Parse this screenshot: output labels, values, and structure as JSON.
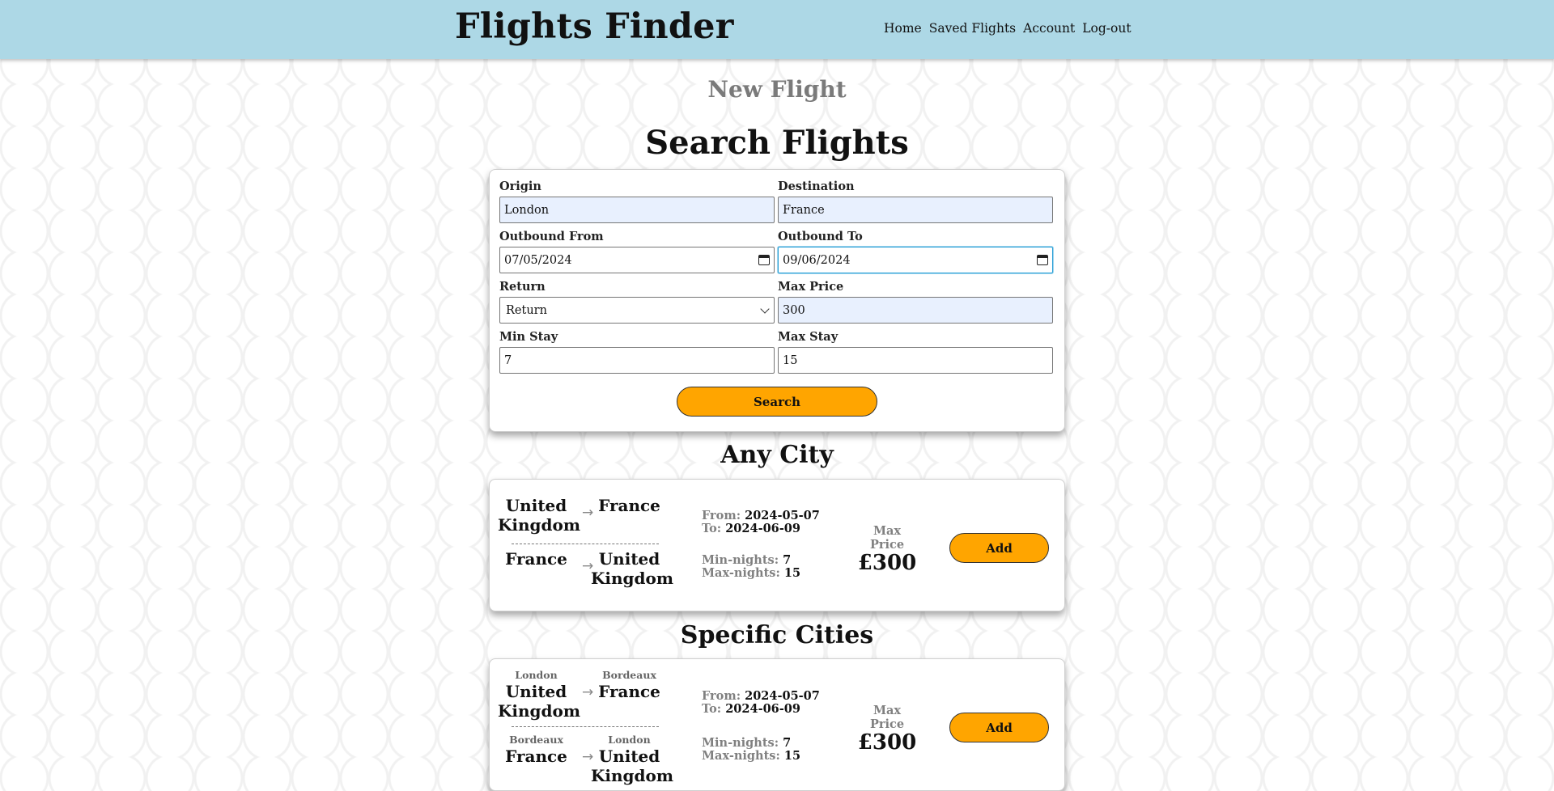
{
  "header": {
    "brand": "Flights Finder",
    "nav": [
      "Home",
      "Saved Flights",
      "Account",
      "Log-out"
    ]
  },
  "page": {
    "new_flight": "New Flight",
    "search_title": "Search Flights",
    "any_city_title": "Any City",
    "specific_cities_title": "Specific Cities"
  },
  "form": {
    "origin": {
      "label": "Origin",
      "value": "London"
    },
    "destination": {
      "label": "Destination",
      "value": "France"
    },
    "outbound_from": {
      "label": "Outbound From",
      "value": "07/05/2024"
    },
    "outbound_to": {
      "label": "Outbound To",
      "value": "09/06/2024"
    },
    "return": {
      "label": "Return",
      "value": "Return"
    },
    "max_price": {
      "label": "Max Price",
      "value": "300"
    },
    "min_stay": {
      "label": "Min Stay",
      "value": "7"
    },
    "max_stay": {
      "label": "Max Stay",
      "value": "15"
    },
    "search_label": "Search"
  },
  "results": {
    "any_city": {
      "out_from": "United Kingdom",
      "out_to": "France",
      "back_from": "France",
      "back_to": "United Kingdom",
      "arrow": "→",
      "from_label": "From:",
      "from_value": "2024-05-07",
      "to_label": "To:",
      "to_value": "2024-06-09",
      "min_label": "Min-nights:",
      "min_value": "7",
      "max_label": "Max-nights:",
      "max_value": "15",
      "price_label": "Max Price",
      "price_value": "£300",
      "add_label": "Add"
    },
    "specific": {
      "out_from_city": "London",
      "out_from": "United Kingdom",
      "out_to_city": "Bordeaux",
      "out_to": "France",
      "back_from_city": "Bordeaux",
      "back_from": "France",
      "back_to_city": "London",
      "back_to": "United Kingdom",
      "arrow": "→",
      "from_label": "From:",
      "from_value": "2024-05-07",
      "to_label": "To:",
      "to_value": "2024-06-09",
      "min_label": "Min-nights:",
      "min_value": "7",
      "max_label": "Max-nights:",
      "max_value": "15",
      "price_label": "Max Price",
      "price_value": "£300",
      "add_label": "Add"
    }
  },
  "colors": {
    "header_bg": "#add8e6",
    "button_bg": "#ffa500",
    "autofill_bg": "#e8f0fe",
    "focus_border": "#2a9fd6"
  }
}
